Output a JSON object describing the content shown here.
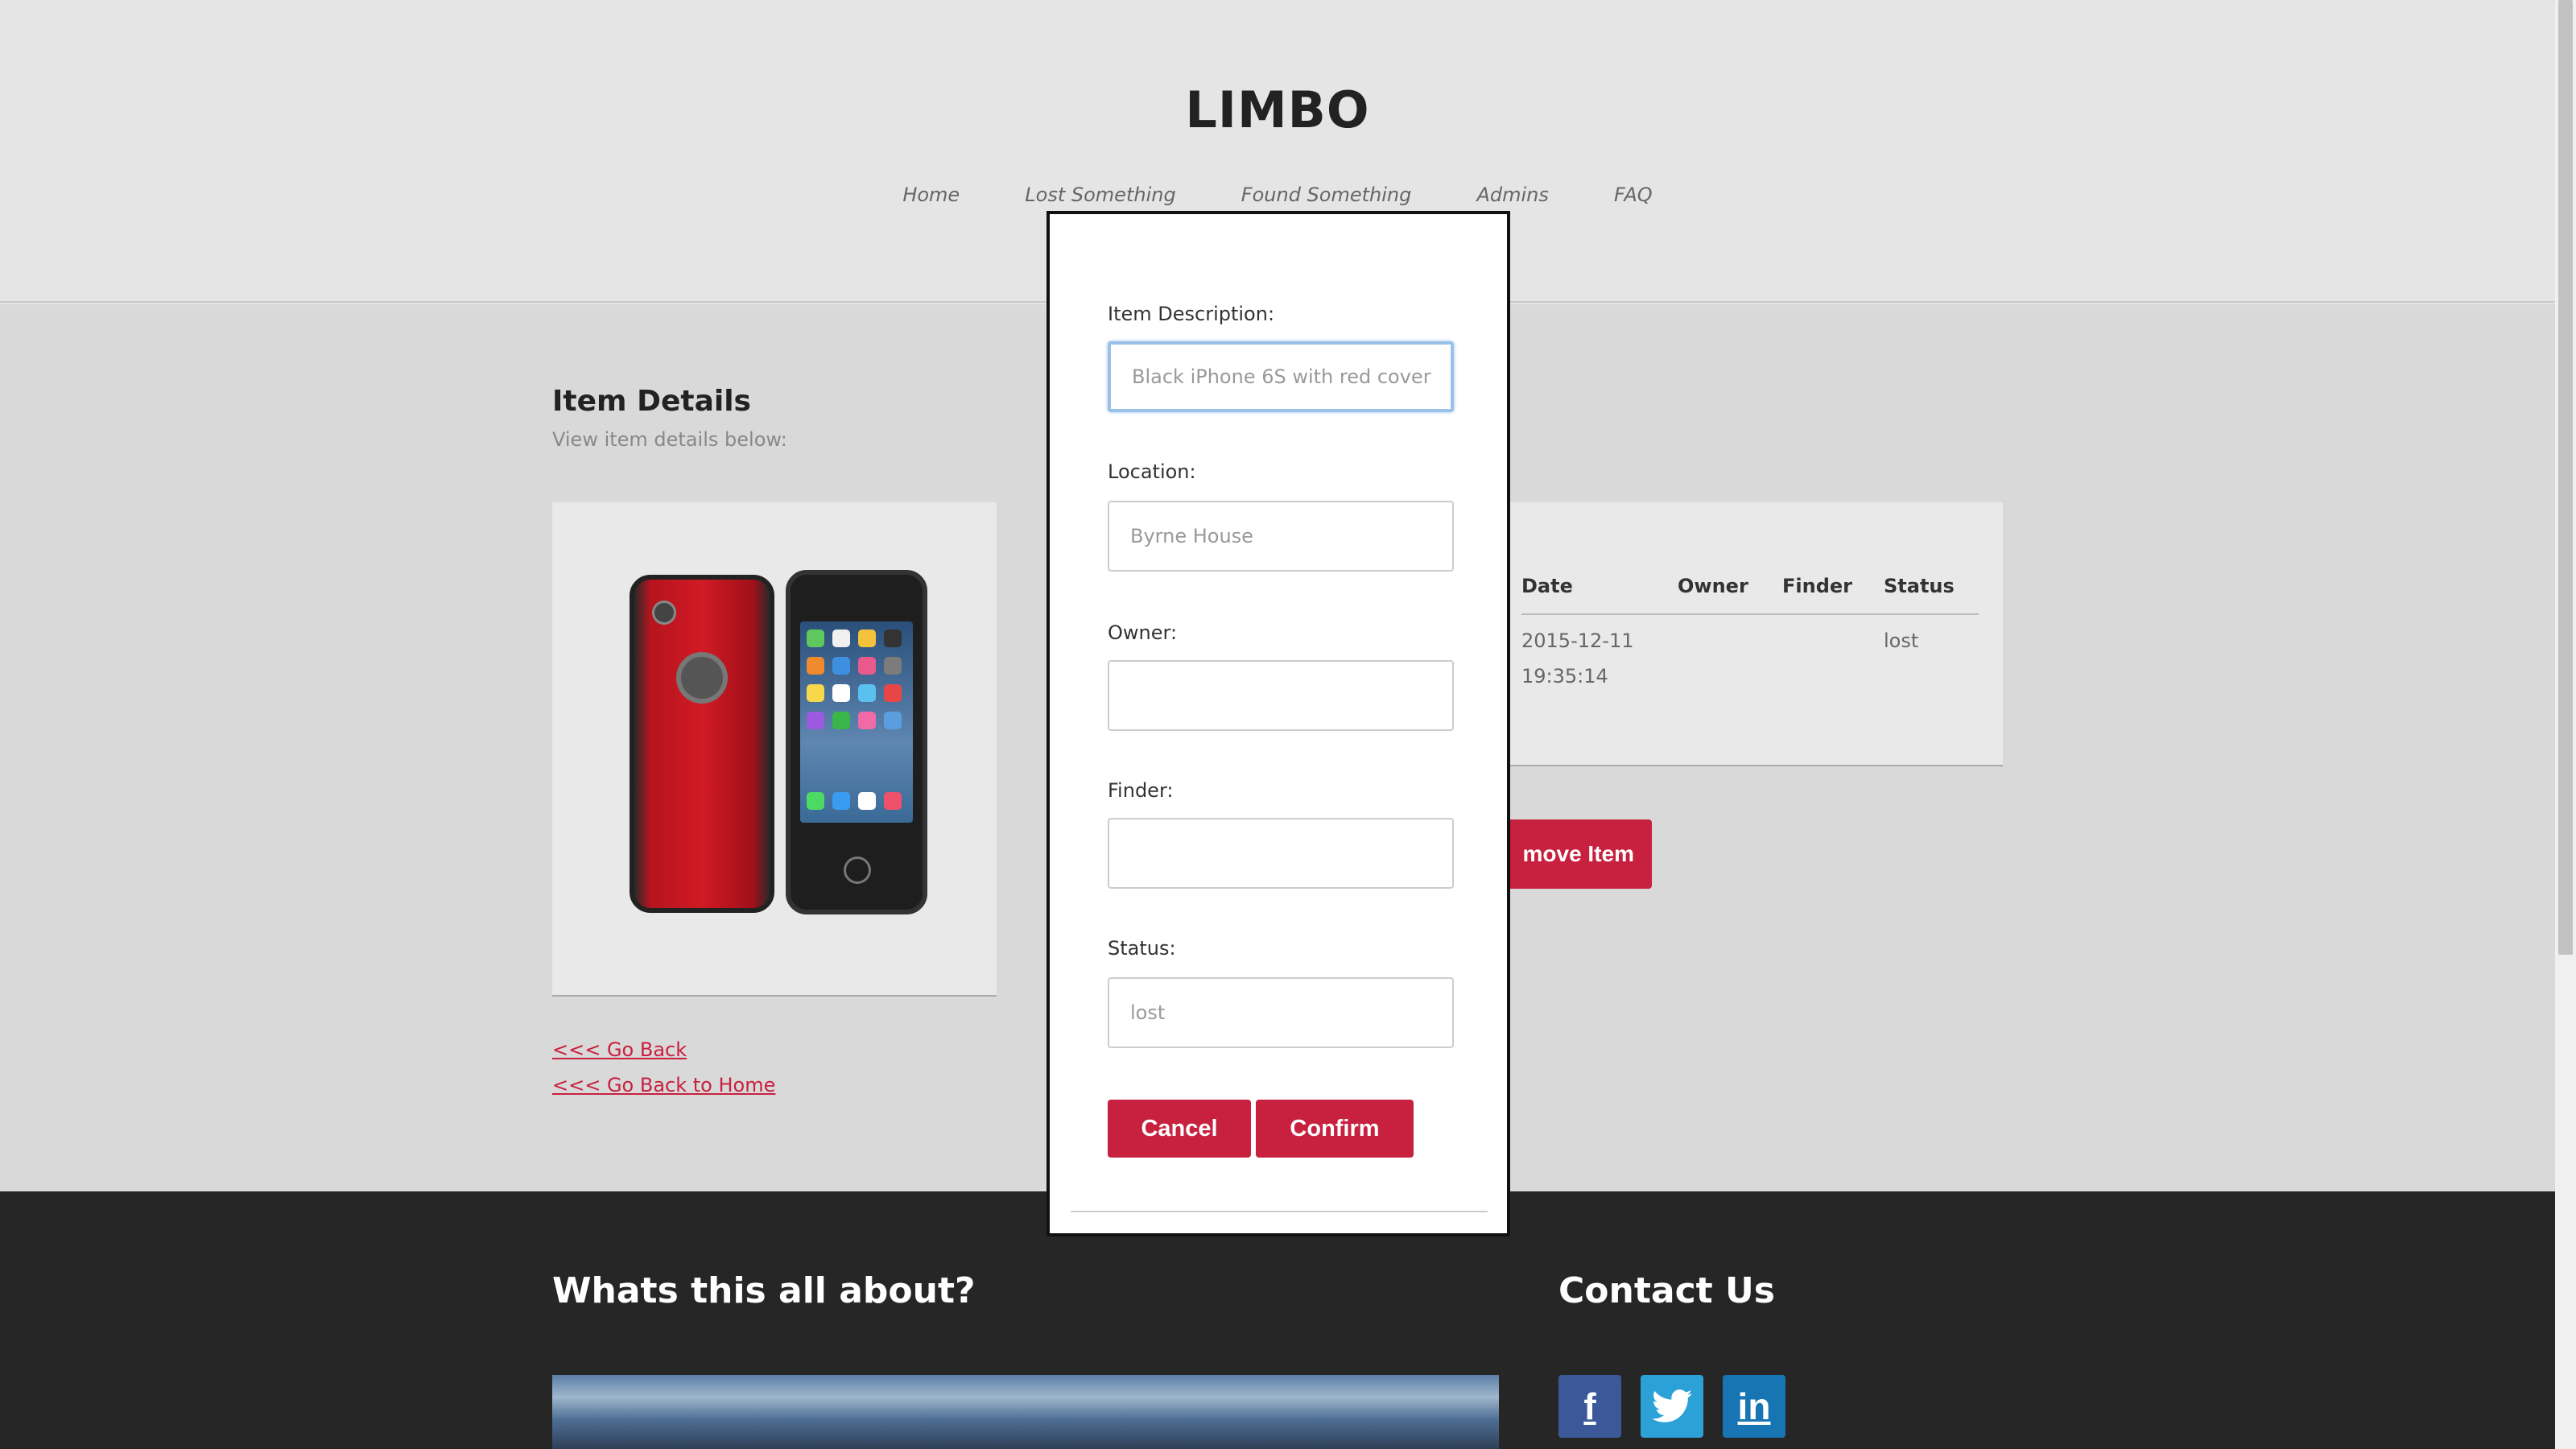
{
  "site": {
    "title": "LIMBO"
  },
  "nav": {
    "items": [
      {
        "label": "Home"
      },
      {
        "label": "Lost Something"
      },
      {
        "label": "Found Something"
      },
      {
        "label": "Admins"
      },
      {
        "label": "FAQ"
      }
    ]
  },
  "item_details": {
    "title": "Item Details",
    "subtitle": "View item details below:",
    "go_back": "<<< Go Back",
    "go_home": "<<< Go Back to Home",
    "remove_button": "move Item"
  },
  "table": {
    "headers": [
      "Date",
      "Owner",
      "Finder",
      "Status"
    ],
    "row": {
      "date_line1": "2015-12-11",
      "date_line2": "19:35:14",
      "owner": "",
      "finder": "",
      "status": "lost"
    }
  },
  "modal": {
    "description": {
      "label": "Item Description:",
      "placeholder": "Black iPhone 6S with red cover"
    },
    "location": {
      "label": "Location:",
      "placeholder": "Byrne House"
    },
    "owner": {
      "label": "Owner:",
      "placeholder": ""
    },
    "finder": {
      "label": "Finder:",
      "placeholder": ""
    },
    "status": {
      "label": "Status:",
      "placeholder": "lost"
    },
    "cancel_label": "Cancel",
    "confirm_label": "Confirm"
  },
  "footer": {
    "about_title": "Whats this all about?",
    "contact_title": "Contact Us",
    "social": [
      {
        "icon": "facebook-icon",
        "glyph": "f"
      },
      {
        "icon": "twitter-icon",
        "glyph": "t"
      },
      {
        "icon": "linkedin-icon",
        "glyph": "in"
      }
    ]
  },
  "colors": {
    "accent": "#c8203f",
    "facebook": "#3b5998",
    "twitter": "#2ba1d8",
    "linkedin": "#1875b4",
    "focus": "#9ac1e9"
  }
}
